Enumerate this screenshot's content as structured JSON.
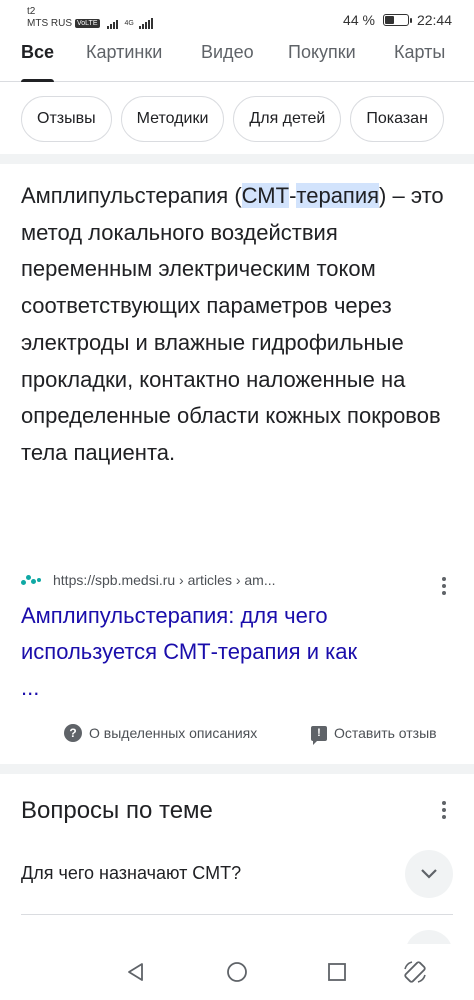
{
  "status_bar": {
    "carrier_line1": "t2",
    "carrier_line2": "MTS RUS",
    "volte_badge": "VoLTE",
    "network_type": "4G",
    "battery_percent": "44 %",
    "battery_level": 0.44,
    "time": "22:44"
  },
  "search_tabs": [
    {
      "label": "Все",
      "active": true
    },
    {
      "label": "Картинки",
      "active": false
    },
    {
      "label": "Видео",
      "active": false
    },
    {
      "label": "Покупки",
      "active": false
    },
    {
      "label": "Карты",
      "active": false
    }
  ],
  "chips": [
    "Отзывы",
    "Методики",
    "Для детей",
    "Показан"
  ],
  "snippet": {
    "term": "Амплипульстерапия (",
    "highlight1": "СМТ",
    "hyphen": "-",
    "highlight2": "терапия",
    "rest": ") – это метод локального воздействия переменным электрическим током соответствующих параметров через электроды и влажные гидрофильные прокладки, контактно наложенные на определенные области кожных покровов тела пациента."
  },
  "source": {
    "url": "https://spb.medsi.ru › articles › am...",
    "favicon_color": "#0fa8a4"
  },
  "result": {
    "title_line1": "Амплипульстерапия: для чего",
    "title_line2": "используется СМТ-терапия и как",
    "title_line3": "..."
  },
  "feedback": {
    "about_label": "О выделенных описаниях",
    "report_label": "Оставить отзыв"
  },
  "people_also_ask": {
    "title": "Вопросы по теме",
    "questions": [
      "Для чего назначают СМТ?"
    ]
  },
  "colors": {
    "link": "#1a0dab",
    "highlight": "#d2e3fc",
    "text": "#202124",
    "secondary": "#5f6368"
  }
}
